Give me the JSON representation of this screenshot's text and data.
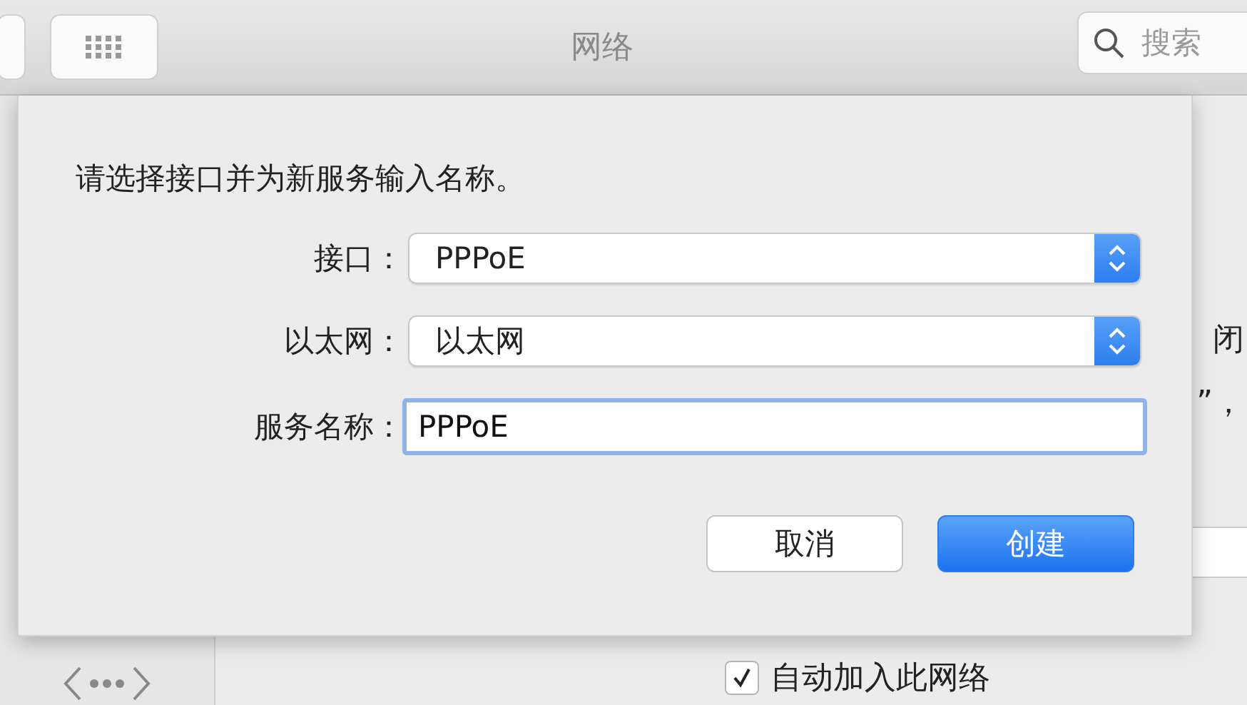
{
  "toolbar": {
    "title": "网络",
    "search": {
      "placeholder": "搜索"
    }
  },
  "background": {
    "fragments": [
      "闭",
      "”，"
    ],
    "checkbox": {
      "label": "自动加入此网络",
      "checked": true
    }
  },
  "sheet": {
    "instruction": "请选择接口并为新服务输入名称。",
    "fields": [
      {
        "kind": "popup",
        "label": "接口：",
        "value": "PPPoE"
      },
      {
        "kind": "popup",
        "label": "以太网：",
        "value": "以太网"
      },
      {
        "kind": "text",
        "label": "服务名称：",
        "value": "PPPoE",
        "focused": true
      }
    ],
    "buttons": [
      {
        "label": "取消",
        "primary": false
      },
      {
        "label": "创建",
        "primary": true
      }
    ]
  }
}
